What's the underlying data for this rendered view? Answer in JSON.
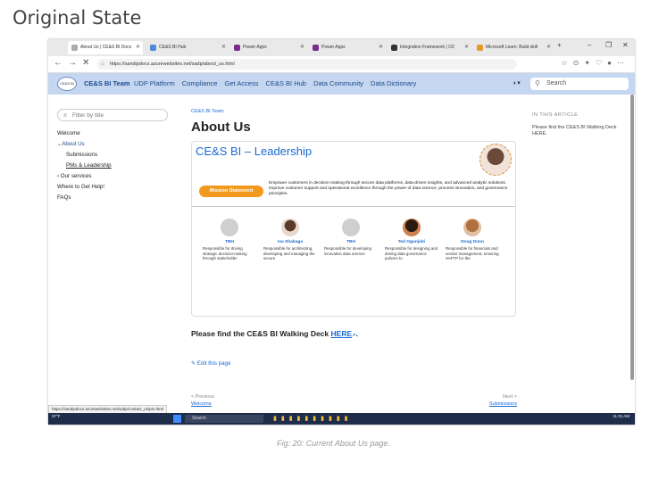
{
  "heading": "Original State",
  "caption": "Fig: 20: Current About Us page.",
  "browser": {
    "tabs": [
      {
        "label": "About Us | CE&S BI Docs",
        "active": true
      },
      {
        "label": "CE&S BI Hub",
        "active": false
      },
      {
        "label": "Power Apps",
        "active": false
      },
      {
        "label": "Power Apps",
        "active": false
      },
      {
        "label": "Integration Framework | O2",
        "active": false
      },
      {
        "label": "Microsoft Learn: Build skill",
        "active": false
      }
    ],
    "new_tab": "+",
    "url": "https://sandipdocs.azurewebsites.net/sadp/about_us.html"
  },
  "site": {
    "logo": "CE&S BI",
    "title": "CE&S BI Team",
    "nav": [
      "UDP Platform",
      "Compliance",
      "Get Access",
      "CE&S BI Hub",
      "Data Community",
      "Data Dictionary"
    ],
    "search_placeholder": "Search"
  },
  "sidebar": {
    "filter_placeholder": "Filter by title",
    "items": [
      {
        "label": "Welcome"
      },
      {
        "label": "About Us"
      },
      {
        "label": "Submissions"
      },
      {
        "label": "PMs & Leadership"
      },
      {
        "label": "Our services"
      },
      {
        "label": "Where to Get Help!"
      },
      {
        "label": "FAQs"
      }
    ]
  },
  "main": {
    "breadcrumb": "CE&S BI Team",
    "title": "About Us",
    "slide": {
      "title": "CE&S BI – Leadership",
      "mission_label": "Mission Statement",
      "mission_text": "Empower customers in decision-making through secure data platforms, data-driven insights, and advanced analytic solutions. Improve customer support and operational excellence through the power of data science, process innovation, and governance principles.",
      "people": [
        {
          "name": "TBH",
          "role": "Responsible for driving strategic decision-making through stakeholder"
        },
        {
          "name": "Isa Shabaga",
          "role": "Responsible for architecting, developing and managing the secure"
        },
        {
          "name": "TBH",
          "role": "Responsible for developing innovative data science"
        },
        {
          "name": "Ted Ogunjobi",
          "role": "Responsible for designing and driving data governance policies to"
        },
        {
          "name": "Doug Dunn",
          "role": "Responsible for financials and vendor management, ensuring SAFTP for the"
        }
      ]
    },
    "walking_deck_prefix": "Please find the CE&S BI Walking Deck",
    "walking_deck_link": "HERE",
    "walking_deck_suffix": ".",
    "edit_label": "Edit this page"
  },
  "toc": {
    "heading": "IN THIS ARTICLE",
    "text": "Please find the CE&S BI Walking Deck HERE."
  },
  "pager": {
    "prev_label": "< Previous",
    "prev_title": "Welcome",
    "next_label": "Next >",
    "next_title": "Submissions"
  },
  "status_url": "https://sandipdocs.azurewebsites.net/sadp/contact_us/pm.html",
  "taskbar": {
    "search_placeholder": "Search",
    "weather": "37°F",
    "time": "11:31 AM"
  }
}
